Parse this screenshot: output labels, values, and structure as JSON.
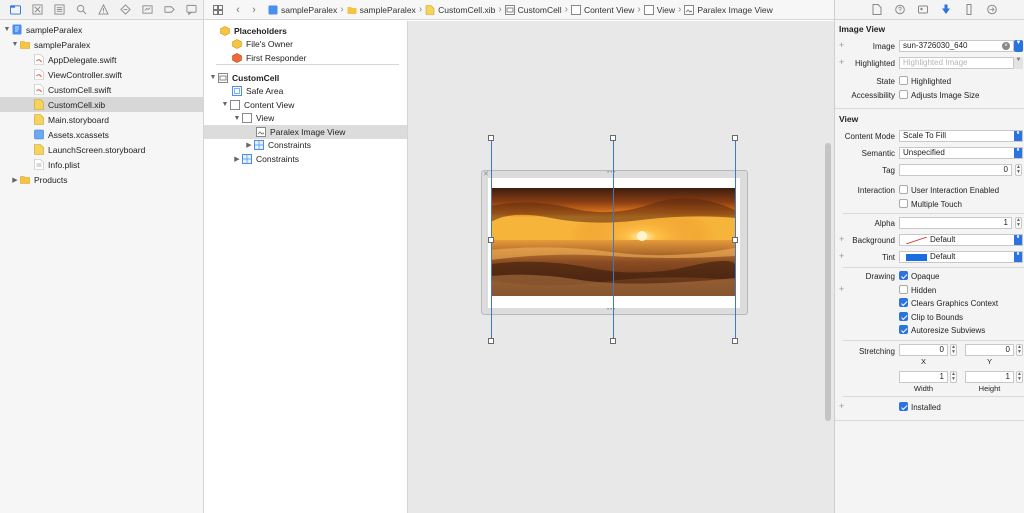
{
  "navigator": {
    "tree": [
      {
        "label": "sampleParalex",
        "icon": "project-icon",
        "disclosure": "▼"
      },
      {
        "label": "sampleParalex",
        "icon": "folder-icon",
        "disclosure": "▼"
      },
      {
        "label": "AppDelegate.swift",
        "icon": "swift-file-icon",
        "disclosure": ""
      },
      {
        "label": "ViewController.swift",
        "icon": "swift-file-icon",
        "disclosure": ""
      },
      {
        "label": "CustomCell.swift",
        "icon": "swift-file-icon",
        "disclosure": ""
      },
      {
        "label": "CustomCell.xib",
        "icon": "xib-file-icon",
        "disclosure": "",
        "selected": true
      },
      {
        "label": "Main.storyboard",
        "icon": "storyboard-file-icon",
        "disclosure": ""
      },
      {
        "label": "Assets.xcassets",
        "icon": "assets-icon",
        "disclosure": ""
      },
      {
        "label": "LaunchScreen.storyboard",
        "icon": "storyboard-file-icon",
        "disclosure": ""
      },
      {
        "label": "Info.plist",
        "icon": "plist-file-icon",
        "disclosure": ""
      },
      {
        "label": "Products",
        "icon": "folder-icon",
        "disclosure": "▶"
      }
    ]
  },
  "jumpbar": {
    "crumbs": [
      "sampleParalex",
      "sampleParalex",
      "CustomCell.xib",
      "CustomCell",
      "Content View",
      "View",
      "Paralex Image View"
    ]
  },
  "outline": {
    "placeholders": "Placeholders",
    "files_owner": "File's Owner",
    "first_responder": "First Responder",
    "custom_cell": "CustomCell",
    "safe_area": "Safe Area",
    "content_view": "Content View",
    "view": "View",
    "paralex_image_view": "Paralex Image View",
    "constraints_inner": "Constraints",
    "constraints_outer": "Constraints"
  },
  "inspector": {
    "image_view": {
      "title": "Image View",
      "image_label": "Image",
      "image_value": "sun-3726030_640",
      "highlighted_label": "Highlighted",
      "highlighted_placeholder": "Highlighted Image",
      "state_label": "State",
      "state_checkbox": "Highlighted",
      "accessibility_label": "Accessibility",
      "accessibility_checkbox": "Adjusts Image Size"
    },
    "view": {
      "title": "View",
      "content_mode_label": "Content Mode",
      "content_mode_value": "Scale To Fill",
      "semantic_label": "Semantic",
      "semantic_value": "Unspecified",
      "tag_label": "Tag",
      "tag_value": "0",
      "interaction_label": "Interaction",
      "user_interaction": "User Interaction Enabled",
      "multiple_touch": "Multiple Touch",
      "alpha_label": "Alpha",
      "alpha_value": "1",
      "background_label": "Background",
      "background_value": "Default",
      "tint_label": "Tint",
      "tint_value": "Default",
      "drawing_label": "Drawing",
      "opaque": "Opaque",
      "hidden": "Hidden",
      "clears_graphics": "Clears Graphics Context",
      "clip_to_bounds": "Clip to Bounds",
      "autoresize_subviews": "Autoresize Subviews",
      "stretching_label": "Stretching",
      "stretch_x_value": "0",
      "stretch_y_value": "0",
      "stretch_width_value": "1",
      "stretch_height_value": "1",
      "x_label": "X",
      "y_label": "Y",
      "width_label": "Width",
      "height_label": "Height",
      "installed": "Installed"
    }
  },
  "colors": {
    "accent": "#2b74e0",
    "selection_line": "#3d79c9",
    "tint_swatch": "#1a6de0",
    "background_swatch_line": "#e03a3a"
  }
}
